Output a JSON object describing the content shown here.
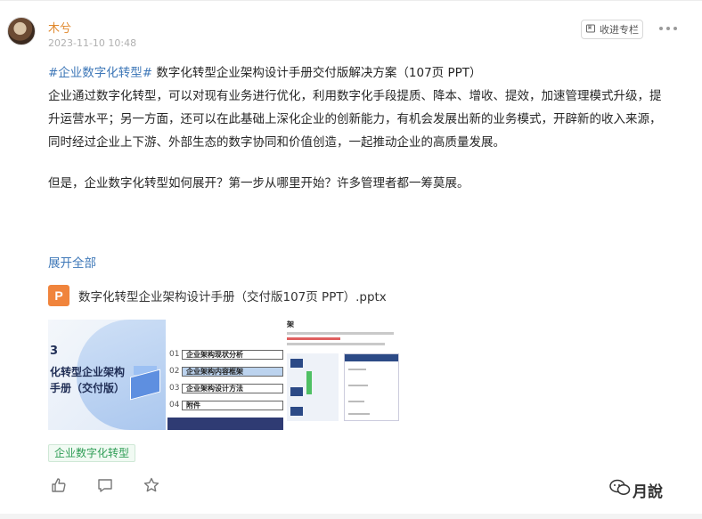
{
  "author": {
    "name": "木兮",
    "time": "2023-11-10 10:48"
  },
  "header": {
    "collect_label": "收进专栏"
  },
  "post": {
    "topic": "#企业数字化转型#",
    "title": " 数字化转型企业架构设计手册交付版解决方案（107页 PPT）",
    "p1": "企业通过数字化转型，可以对现有业务进行优化，利用数字化手段提质、降本、增收、提效，加速管理模式升级，提升运营水平；另一方面，还可以在此基础上深化企业的创新能力，有机会发展出新的业务模式，开辟新的收入来源，同时经过企业上下游、外部生态的数字协同和价值创造，一起推动企业的高质量发展。",
    "p2": "但是，企业数字化转型如何展开？第一步从哪里开始？许多管理者都一筹莫展。",
    "expand_label": "展开全部"
  },
  "attachment": {
    "icon_letter": "P",
    "filename": "数字化转型企业架构设计手册（交付版107页 PPT）.pptx"
  },
  "previews": {
    "slide1": {
      "num": "3",
      "line1": "化转型企业架构",
      "line2": "手册（交付版）"
    },
    "slide2": {
      "rows": [
        {
          "num": "01",
          "label": "企业架构现状分析"
        },
        {
          "num": "02",
          "label": "企业架构内容框架"
        },
        {
          "num": "03",
          "label": "企业架构设计方法"
        },
        {
          "num": "04",
          "label": "附件"
        }
      ]
    },
    "slide3": {
      "title": "架"
    }
  },
  "tag": {
    "label": "企业数字化转型"
  },
  "watermark": {
    "text": "月說",
    "small": "看"
  },
  "colors": {
    "accent": "#e0882c",
    "link": "#3f78b8",
    "tag_green": "#2e9d55",
    "ppt_orange": "#f0843c"
  },
  "icons": {
    "like": "thumbs-up-icon",
    "comment": "comment-icon",
    "favorite": "star-icon",
    "more": "more-dots-icon"
  }
}
